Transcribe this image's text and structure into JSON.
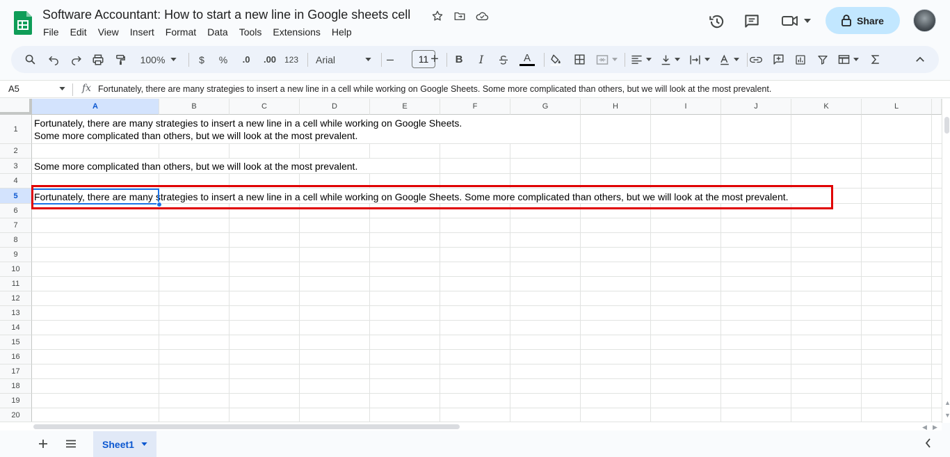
{
  "document": {
    "title": "Software Accountant: How to start a new line in Google sheets cell"
  },
  "menu": [
    "File",
    "Edit",
    "View",
    "Insert",
    "Format",
    "Data",
    "Tools",
    "Extensions",
    "Help"
  ],
  "share": {
    "label": "Share"
  },
  "toolbar": {
    "zoom": "100%",
    "currency": "$",
    "percent": "%",
    "decrease_decimal": ".0",
    "increase_decimal": ".00",
    "number_format": "123",
    "font": "Arial",
    "font_size": "11",
    "bold": "B",
    "italic": "I",
    "text_color": "A",
    "minus": "–",
    "plus": "+"
  },
  "formula_bar": {
    "name_box": "A5",
    "fx": "fx",
    "content": "Fortunately, there are many strategies to insert a new line in a cell while working on Google Sheets. Some more complicated than others, but we will look at the most prevalent."
  },
  "columns": [
    "A",
    "B",
    "C",
    "D",
    "E",
    "F",
    "G",
    "H",
    "I",
    "J",
    "K",
    "L"
  ],
  "rows": [
    "1",
    "2",
    "3",
    "4",
    "5",
    "6",
    "7",
    "8",
    "9",
    "10",
    "11",
    "12",
    "13",
    "14",
    "15",
    "16",
    "17",
    "18",
    "19",
    "20"
  ],
  "cells": {
    "a1_line1": "Fortunately, there are many strategies to insert a new line in a cell while working on Google Sheets.",
    "a1_line2": "Some more complicated than others, but we will look at the most prevalent.",
    "a3": "Some more complicated than others, but we will look at the most prevalent.",
    "a5": "Fortunately, there are many strategies to insert a new line in a cell while working on Google Sheets. Some more complicated than others, but we will look at the most prevalent."
  },
  "selected_cell": "A5",
  "sheets": [
    {
      "name": "Sheet1",
      "active": true
    }
  ],
  "colors": {
    "accent": "#0b57d0",
    "share_bg": "#c2e7ff",
    "highlight_box": "#e00000",
    "selection": "#1a73e8"
  }
}
